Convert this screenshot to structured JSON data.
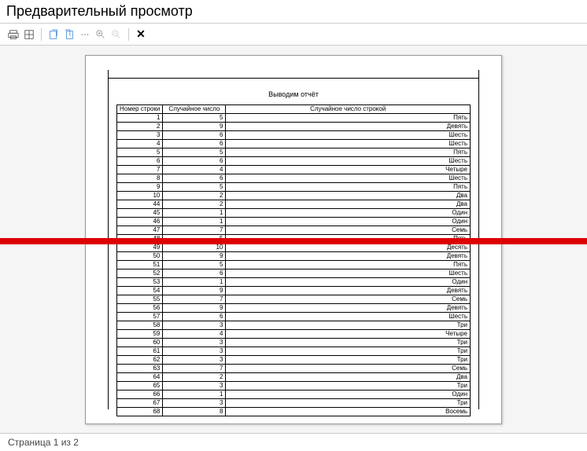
{
  "header": {
    "title": "Предварительный просмотр"
  },
  "toolbar": {
    "print": "print",
    "grid": "grid",
    "newwin": "newwin",
    "newwin2": "newwin2",
    "dots": "dots",
    "zoomin": "zoomin",
    "zoomout": "zoomout",
    "close": "close"
  },
  "report": {
    "title": "Выводим отчёт",
    "columns": [
      "Номер строки",
      "Случайное число",
      "Случайное число строкой"
    ],
    "rows": [
      {
        "n": "1",
        "v": "5",
        "s": "Пять"
      },
      {
        "n": "2",
        "v": "9",
        "s": "Девять"
      },
      {
        "n": "3",
        "v": "6",
        "s": "Шесть"
      },
      {
        "n": "4",
        "v": "6",
        "s": "Шесть"
      },
      {
        "n": "5",
        "v": "5",
        "s": "Пять"
      },
      {
        "n": "6",
        "v": "6",
        "s": "Шесть"
      },
      {
        "n": "7",
        "v": "4",
        "s": "Четыре"
      },
      {
        "n": "8",
        "v": "6",
        "s": "Шесть"
      },
      {
        "n": "9",
        "v": "5",
        "s": "Пять"
      },
      {
        "n": "10",
        "v": "2",
        "s": "Два"
      },
      {
        "n": "44",
        "v": "2",
        "s": "Два"
      },
      {
        "n": "45",
        "v": "1",
        "s": "Один"
      },
      {
        "n": "46",
        "v": "1",
        "s": "Один"
      },
      {
        "n": "47",
        "v": "7",
        "s": "Семь"
      },
      {
        "n": "48",
        "v": "5",
        "s": "Пять"
      },
      {
        "n": "49",
        "v": "10",
        "s": "Десять"
      },
      {
        "n": "50",
        "v": "9",
        "s": "Девять"
      },
      {
        "n": "51",
        "v": "5",
        "s": "Пять"
      },
      {
        "n": "52",
        "v": "6",
        "s": "Шесть"
      },
      {
        "n": "53",
        "v": "1",
        "s": "Один"
      },
      {
        "n": "54",
        "v": "9",
        "s": "Девять"
      },
      {
        "n": "55",
        "v": "7",
        "s": "Семь"
      },
      {
        "n": "56",
        "v": "9",
        "s": "Девять"
      },
      {
        "n": "57",
        "v": "6",
        "s": "Шесть"
      },
      {
        "n": "58",
        "v": "3",
        "s": "Три"
      },
      {
        "n": "59",
        "v": "4",
        "s": "Четыре"
      },
      {
        "n": "60",
        "v": "3",
        "s": "Три"
      },
      {
        "n": "61",
        "v": "3",
        "s": "Три"
      },
      {
        "n": "62",
        "v": "3",
        "s": "Три"
      },
      {
        "n": "63",
        "v": "7",
        "s": "Семь"
      },
      {
        "n": "64",
        "v": "2",
        "s": "Два"
      },
      {
        "n": "65",
        "v": "3",
        "s": "Три"
      },
      {
        "n": "66",
        "v": "1",
        "s": "Один"
      },
      {
        "n": "67",
        "v": "3",
        "s": "Три"
      },
      {
        "n": "68",
        "v": "8",
        "s": "Восемь"
      }
    ]
  },
  "status": {
    "page_text": "Страница 1 из 2"
  }
}
